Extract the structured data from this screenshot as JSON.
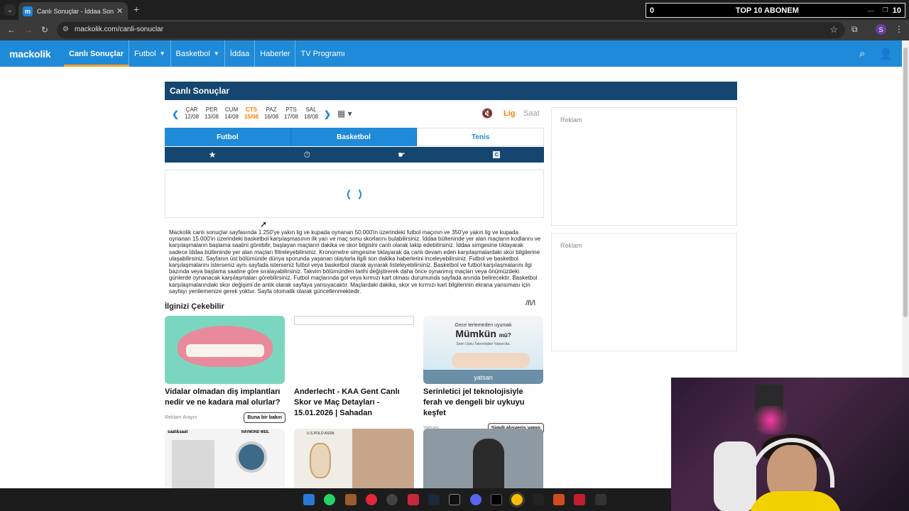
{
  "browser": {
    "tab_title": "Canlı Sonuçlar - İddaa Sonuçları",
    "url": "mackolik.com/canli-sonuclar",
    "profile_initial": "S"
  },
  "stream_overlay": {
    "left": "0",
    "center": "TOP 10 ABONEM",
    "right": "10"
  },
  "site": {
    "logo": "mackolik",
    "menu": [
      {
        "label": "Canlı Sonuçlar"
      },
      {
        "label": "Futbol"
      },
      {
        "label": "Basketbol"
      },
      {
        "label": "İddaa"
      },
      {
        "label": "Haberler"
      },
      {
        "label": "TV Programı"
      }
    ]
  },
  "main": {
    "panel_title": "Canlı Sonuçlar",
    "days": [
      {
        "name": "ÇAR",
        "date": "12/08"
      },
      {
        "name": "PER",
        "date": "13/08"
      },
      {
        "name": "CUM",
        "date": "14/08"
      },
      {
        "name": "CTS",
        "date": "15/08"
      },
      {
        "name": "PAZ",
        "date": "16/08"
      },
      {
        "name": "PTS",
        "date": "17/08"
      },
      {
        "name": "SAL",
        "date": "18/08"
      }
    ],
    "sort_lig": "Lig",
    "sort_saat": "Saat",
    "sport_tabs": [
      {
        "label": "Futbol"
      },
      {
        "label": "Basketbol"
      },
      {
        "label": "Tenis"
      }
    ],
    "filter_c": "C",
    "description": "Mackolik canlı sonuçlar sayfasında 1.250'ye yakın lig ve kupada oynanan 50.000'in üzerindeki futbol maçının ve 350'ye yakın lig ve kupada oynanan 15.000'in üzerindeki basketbol karşılaşmasının ilk yarı ve maç sonu skorlarını bulabilirsiniz. İddaa bülteninde yer alan maçların kodlarını ve karşılaşmaların başlama saatini görebilir, başlayan maçların dakika ve skor bilgisini canlı olarak takip edebilirsiniz. İddaa simgesine tıklayarak sadece İddaa bülteninde yer alan maçları filtreleyebilirsiniz. Kronometre simgesine tıklayarak da canlı devam eden karşılaşmalardaki skor bilgilerine ulaşabilirsiniz. Sayfanın üst bölümünde dünya sporunda yaşanan olaylarla ilgili son dakika haberlerini inceleyebilirsiniz. Futbol ve basketbol karşılaşmalarını isterseniz aynı sayfada isterseniz futbol veya basketbol olarak ayırarak listeleyebilirsiniz. Basketbol ve futbol karşılaşmalarını ilgi bazında veya başlama saatine göre sıralayabilirsiniz. Takvim bölümünden tarihi değiştirerek daha önce oynanmış maçları veya önümüzdeki günlerde oynanacak karşılaşmaları görebilirsiniz. Futbol maçlarında gol veya kırmızı kart olması durumunda sayfada anında belirecektir. Basketbol karşılaşmalarındaki skor değişimi de anlık olarak sayfaya yansıyacaktır. Maçlardaki dakika, skor ve kırmızı kart bilgilerinin ekrana yansıması için sayfayı yenilemenize gerek yoktur. Sayfa otomatik olarak güncellenmektedir."
  },
  "suggested": {
    "title": "İlginizi Çekebilir",
    "cards": [
      {
        "headline": "Vidalar olmadan diş implantları nedir ve ne kadara mal olurlar?",
        "source": "Reklam Arayın",
        "button": "Buna bir bakın"
      },
      {
        "headline": "Anderlecht - KAA Gent Canlı Skor ve Maç Detayları - 15.01.2026 | Sahadan",
        "source": "",
        "button": ""
      },
      {
        "headline": "Serinletici jel teknolojisiyle ferah ve dengeli bir uykuyu keşfet",
        "source": "Yatsan",
        "button": "Şimdi alışveriş yapın"
      }
    ],
    "ad3_text1": "Gece terlemeden uyumak",
    "ad3_text2": "Mümkün",
    "ad3_text3": "mü?",
    "ad3_text4": "Serin Uyku Teknolojileri Yatsan'da.",
    "ad3_brand": "yatsan",
    "row2_brand1": "saat&saat",
    "row2_brand2": "RAYMOND WEIL",
    "row2_brand3": "U.S.POLO ASSN."
  },
  "ads": {
    "label": "Reklam"
  },
  "colors": {
    "header_blue": "#1f8ad8",
    "panel_navy": "#14466f",
    "accent_orange": "#ff7d00"
  }
}
